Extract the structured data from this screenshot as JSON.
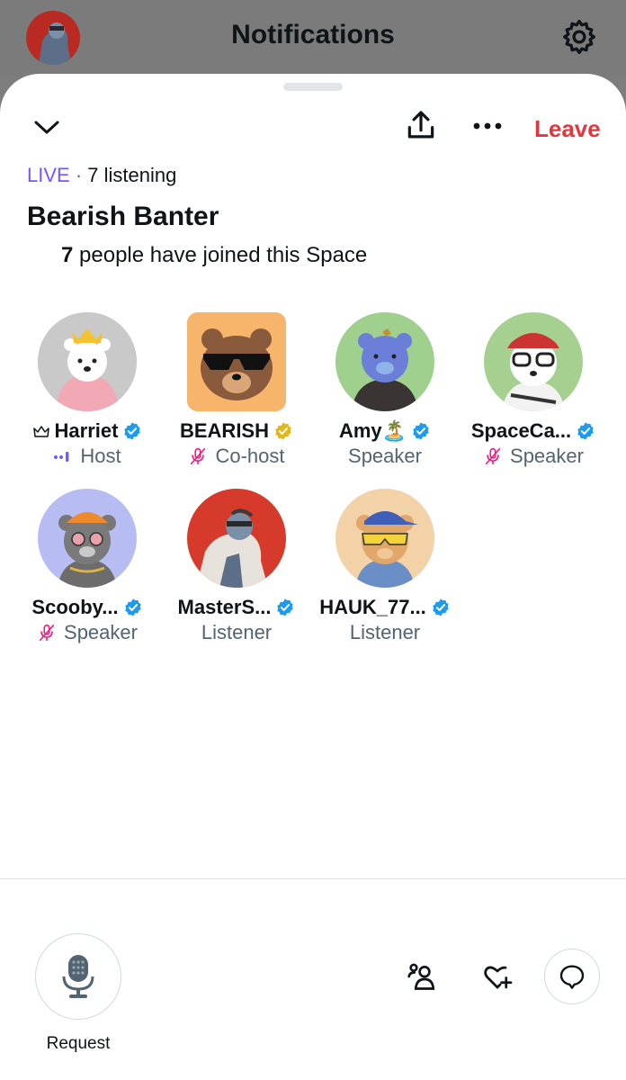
{
  "header": {
    "title": "Notifications",
    "avatar_icon": "user-avatar",
    "settings_icon": "gear-icon"
  },
  "space": {
    "collapse_icon": "chevron-down-icon",
    "share_icon": "share-icon",
    "more_icon": "more-icon",
    "leave_label": "Leave",
    "live_label": "LIVE",
    "separator": "·",
    "listening": "7 listening",
    "title": "Bearish Banter",
    "joined_count": "7",
    "joined_text": "people have joined this Space"
  },
  "participants": [
    {
      "name": "Harriet",
      "role": "Host",
      "badge": "blue",
      "avatar_bg": "#c9c9c9"
    },
    {
      "name": "BEARISH",
      "role": "Co-host",
      "badge": "gold",
      "avatar_bg": "#f7b46b"
    },
    {
      "name": "Amy🏝️",
      "role": "Speaker",
      "badge": "blue",
      "avatar_bg": "#9fd08d"
    },
    {
      "name": "SpaceCa...",
      "role": "Speaker",
      "badge": "blue",
      "avatar_bg": "#a6d090"
    },
    {
      "name": "Scooby...",
      "role": "Speaker",
      "badge": "blue",
      "avatar_bg": "#b7bdf2"
    },
    {
      "name": "MasterS...",
      "role": "Listener",
      "badge": "blue",
      "avatar_bg": "#d63a2a"
    },
    {
      "name": "HAUK_77...",
      "role": "Listener",
      "badge": "blue",
      "avatar_bg": "#f3d2a8"
    }
  ],
  "bottom": {
    "request_label": "Request",
    "request_icon": "microphone-icon",
    "people_icon": "people-icon",
    "reaction_icon": "heart-plus-icon",
    "chat_icon": "chat-bubble-icon"
  },
  "colors": {
    "accent_live": "#7856ff",
    "leave": "#e0383e",
    "verified_blue": "#1d9bf0",
    "verified_gold": "#e2b719",
    "muted_pink": "#f91880"
  }
}
